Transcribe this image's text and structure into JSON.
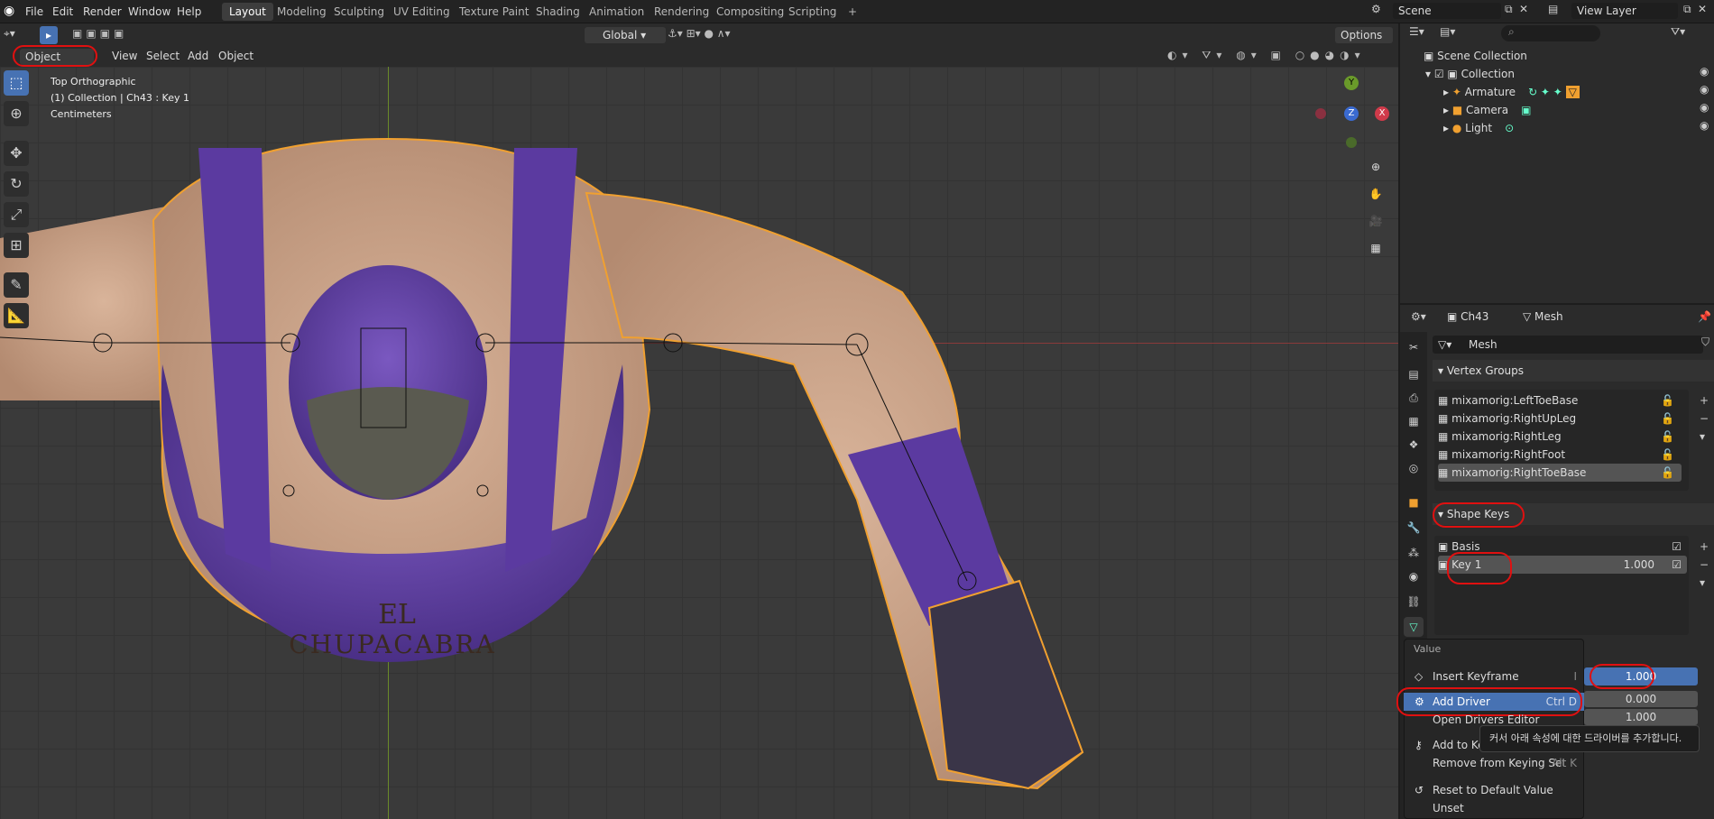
{
  "menu": {
    "items": [
      "File",
      "Edit",
      "Render",
      "Window",
      "Help"
    ]
  },
  "workspaces": {
    "tabs": [
      "Layout",
      "Modeling",
      "Sculpting",
      "UV Editing",
      "Texture Paint",
      "Shading",
      "Animation",
      "Rendering",
      "Compositing",
      "Scripting"
    ],
    "active": "Layout",
    "add_label": "+"
  },
  "scene": {
    "label": "Scene"
  },
  "view_layer": {
    "label": "View Layer"
  },
  "viewport_header": {
    "transform_orientation": "Global",
    "options_label": "Options"
  },
  "mode_bar": {
    "mode": "Object Mode",
    "items": [
      "View",
      "Select",
      "Add",
      "Object"
    ]
  },
  "overlay": {
    "view_name": "Top Orthographic",
    "collection_line": "(1) Collection | Ch43 : Key 1",
    "units": "Centimeters"
  },
  "artwork": {
    "line1": "EL",
    "line2": "CHUPACABRA"
  },
  "gizmo": {
    "y": "Y",
    "z": "Z",
    "x": "X"
  },
  "outliner": {
    "root": "Scene Collection",
    "collection": "Collection",
    "objects": [
      "Armature",
      "Camera",
      "Light"
    ]
  },
  "properties": {
    "object_name": "Ch43",
    "data_name": "Mesh",
    "data_field": "Mesh",
    "vertex_groups_title": "Vertex Groups",
    "vertex_groups": [
      "mixamorig:LeftToeBase",
      "mixamorig:RightUpLeg",
      "mixamorig:RightLeg",
      "mixamorig:RightFoot",
      "mixamorig:RightToeBase"
    ],
    "shape_keys_title": "Shape Keys",
    "shape_keys": [
      {
        "name": "Basis",
        "value": ""
      },
      {
        "name": "Key 1",
        "value": "1.000"
      }
    ],
    "value_fields": [
      "1.000",
      "0.000",
      "1.000"
    ]
  },
  "context_menu": {
    "title": "Value",
    "items": [
      {
        "label": "Insert Keyframe",
        "shortcut": "I"
      },
      {
        "label": "Add Driver",
        "shortcut": "Ctrl D"
      },
      {
        "label": "Open Drivers Editor",
        "shortcut": ""
      },
      {
        "label": "Add to Keying Set",
        "shortcut": ""
      },
      {
        "label": "Remove from Keying Set",
        "shortcut": "Alt K"
      },
      {
        "label": "Reset to Default Value",
        "shortcut": ""
      },
      {
        "label": "Unset",
        "shortcut": ""
      }
    ]
  },
  "tooltip": {
    "text": "커서 아래 속성에 대한 드라이버를 추가합니다."
  },
  "colors": {
    "accent": "#4772b3",
    "highlight": "#e01010",
    "selection": "#f0a030",
    "header": "#2b2b2b"
  }
}
